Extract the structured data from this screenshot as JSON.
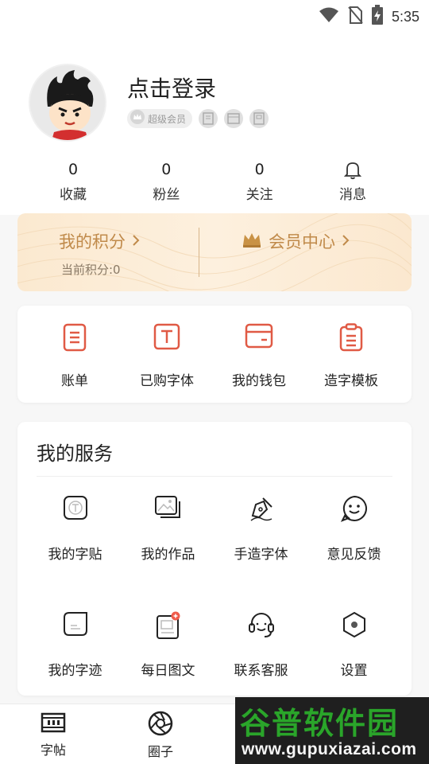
{
  "status_bar": {
    "time": "5:35"
  },
  "profile": {
    "login_text": "点击登录",
    "vip_badge": "超级会员"
  },
  "stats": [
    {
      "value": "0",
      "label": "收藏"
    },
    {
      "value": "0",
      "label": "粉丝"
    },
    {
      "value": "0",
      "label": "关注"
    },
    {
      "value": "",
      "label": "消息",
      "icon": "bell-icon"
    }
  ],
  "points_card": {
    "points_title": "我的积分",
    "points_subtitle": "当前积分:0",
    "vip_center": "会员中心",
    "accent": "#c08a4a"
  },
  "quick_actions": [
    {
      "label": "账单",
      "icon": "bill-icon"
    },
    {
      "label": "已购字体",
      "icon": "purchased-font-icon"
    },
    {
      "label": "我的钱包",
      "icon": "wallet-icon"
    },
    {
      "label": "造字模板",
      "icon": "template-icon"
    }
  ],
  "services": {
    "title": "我的服务",
    "items": [
      {
        "label": "我的字贴",
        "icon": "copybook-icon"
      },
      {
        "label": "我的作品",
        "icon": "works-icon"
      },
      {
        "label": "手造字体",
        "icon": "pen-icon"
      },
      {
        "label": "意见反馈",
        "icon": "feedback-icon"
      },
      {
        "label": "我的字迹",
        "icon": "handwriting-icon"
      },
      {
        "label": "每日图文",
        "icon": "daily-image-icon"
      },
      {
        "label": "联系客服",
        "icon": "headset-icon"
      },
      {
        "label": "设置",
        "icon": "settings-icon"
      }
    ]
  },
  "bottom_nav": [
    {
      "label": "字帖",
      "icon": "copybook-tab-icon"
    },
    {
      "label": "圈子",
      "icon": "aperture-icon"
    }
  ],
  "watermark": {
    "title": "谷普软件园",
    "url": "www.gupuxiazai.com"
  },
  "colors": {
    "icon_red": "#e05a45",
    "gold": "#c08a4a",
    "watermark_green": "#2aa52a"
  }
}
